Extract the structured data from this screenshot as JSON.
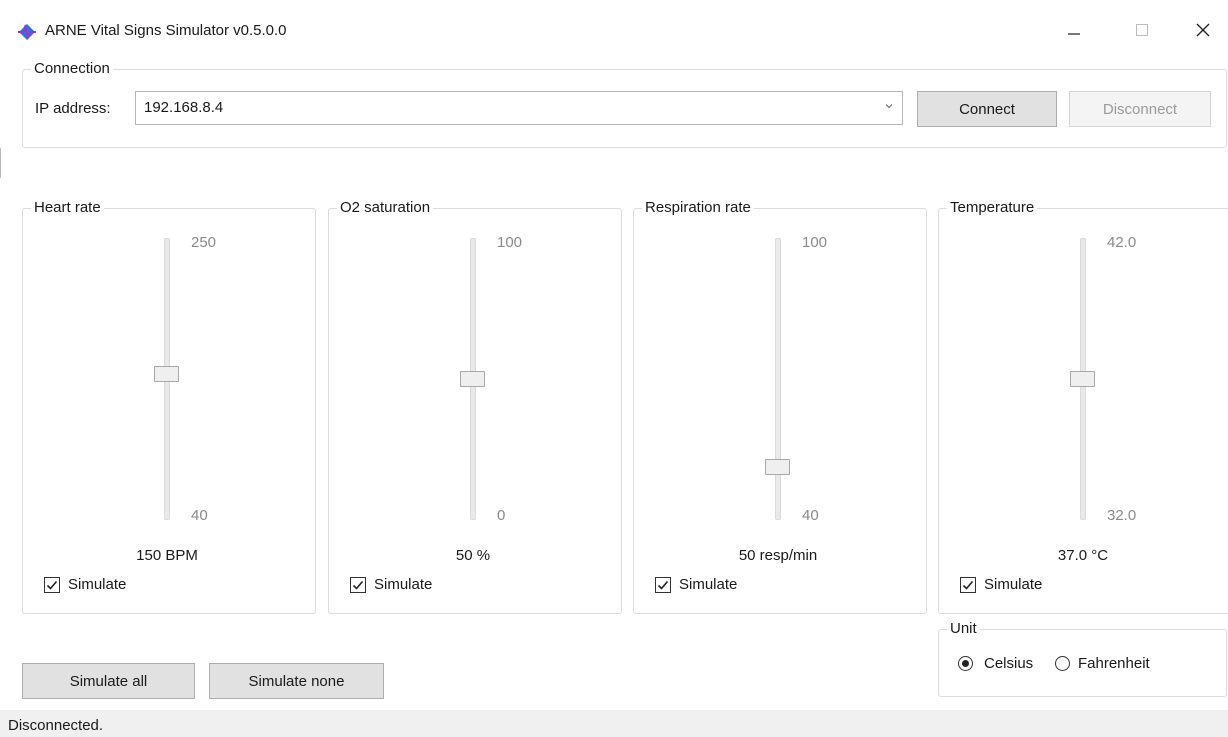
{
  "window": {
    "title": "ARNE Vital Signs Simulator v0.5.0.0",
    "controls": {
      "minimize": "—",
      "maximize": "☐",
      "close": "✕"
    }
  },
  "connection": {
    "legend": "Connection",
    "ip_label": "IP address:",
    "ip_value": "192.168.8.4",
    "connect_label": "Connect",
    "disconnect_label": "Disconnect"
  },
  "vitals": [
    {
      "legend": "Heart rate",
      "max_label": "250",
      "min_label": "40",
      "value_label": "150 BPM",
      "level": 0.52,
      "simulate_label": "Simulate",
      "simulate_checked": true
    },
    {
      "legend": "O2 saturation",
      "max_label": "100",
      "min_label": "0",
      "value_label": "50 %",
      "level": 0.5,
      "simulate_label": "Simulate",
      "simulate_checked": true
    },
    {
      "legend": "Respiration rate",
      "max_label": "100",
      "min_label": "40",
      "value_label": "50 resp/min",
      "level": 0.17,
      "simulate_label": "Simulate",
      "simulate_checked": true
    },
    {
      "legend": "Temperature",
      "max_label": "42.0",
      "min_label": "32.0",
      "value_label": "37.0 °C",
      "level": 0.5,
      "simulate_label": "Simulate",
      "simulate_checked": true
    }
  ],
  "unit": {
    "legend": "Unit",
    "celsius_label": "Celsius",
    "fahrenheit_label": "Fahrenheit",
    "selected": "Celsius"
  },
  "actions": {
    "simulate_all": "Simulate all",
    "simulate_none": "Simulate none"
  },
  "status": {
    "text": "Disconnected."
  },
  "colors": {
    "accent": "#0078d7",
    "icon_blue": "#3a6fd8",
    "icon_purple": "#8a3fd1"
  }
}
